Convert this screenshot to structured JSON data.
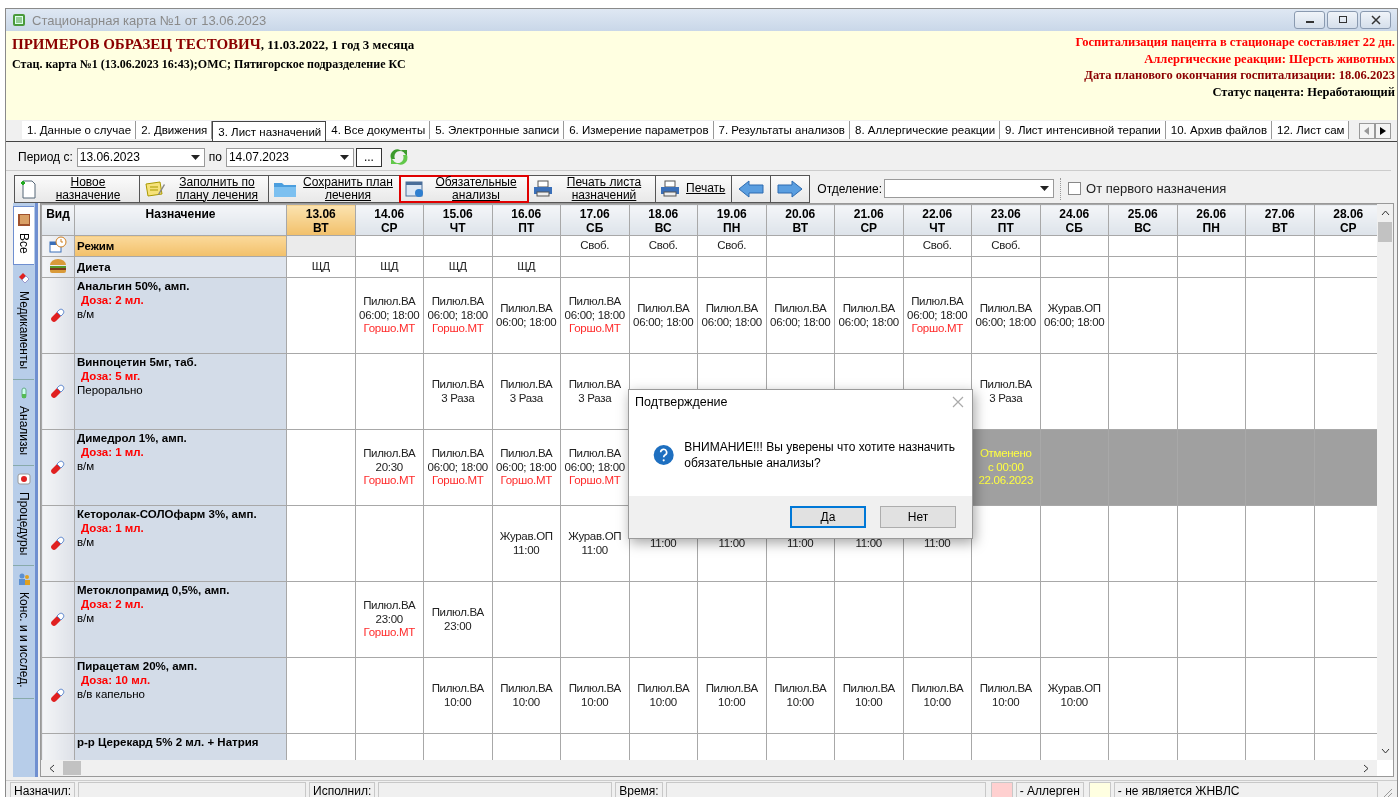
{
  "window": {
    "title": "Стационарная карта №1 от 13.06.2023"
  },
  "header": {
    "patient_name": "ПРИМЕРОВ ОБРАЗЕЦ ТЕСТОВИЧ",
    "birth_info": ", 11.03.2022, 1 год 3 месяца",
    "case_info": "Стац. карта №1 (13.06.2023 16:43);ОМС; Пятигорское подразделение КС",
    "notices": [
      {
        "text": "Госпитализация пацента в стационаре составляет 22 дн.",
        "color": "#ff0000"
      },
      {
        "text": "Аллергические реакции: Шерсть животных",
        "color": "#ff0000"
      },
      {
        "text": "Дата планового окончания госпитализации: 18.06.2023",
        "color": "#8b0000"
      },
      {
        "text": "Статус пацента: Неработающий",
        "color": "#000000"
      }
    ]
  },
  "tabs": [
    {
      "label": "1. Данные о случае",
      "selected": false
    },
    {
      "label": "2. Движения",
      "selected": false
    },
    {
      "label": "3. Лист назначений",
      "selected": true
    },
    {
      "label": "4. Все документы",
      "selected": false
    },
    {
      "label": "5. Электронные записи",
      "selected": false
    },
    {
      "label": "6. Измерение параметров",
      "selected": false
    },
    {
      "label": "7. Результаты анализов",
      "selected": false
    },
    {
      "label": "8. Аллергические реакции",
      "selected": false
    },
    {
      "label": "9. Лист интенсивной терапии",
      "selected": false
    },
    {
      "label": "10. Архив файлов",
      "selected": false
    },
    {
      "label": "12. Лист сам",
      "selected": false
    }
  ],
  "period": {
    "from_label": "Период с:",
    "from": "13.06.2023",
    "to_label": "по",
    "to": "14.07.2023",
    "more_button": "..."
  },
  "toolbar": {
    "buttons": [
      {
        "label": "Новое назначение",
        "highlighted": false
      },
      {
        "label": "Заполнить по плану лечения",
        "highlighted": false
      },
      {
        "label": "Сохранить план лечения",
        "highlighted": false
      },
      {
        "label": "Обязательные анализы",
        "highlighted": true
      },
      {
        "label": "Печать листа назначений",
        "highlighted": false
      },
      {
        "label": "Печать",
        "highlighted": false
      }
    ],
    "department_label": "Отделение:",
    "first_checkbox": {
      "label": "От первого назначения",
      "checked": false
    }
  },
  "side_tabs": [
    {
      "label": "Все",
      "selected": true
    },
    {
      "label": "Медикаменты",
      "selected": false
    },
    {
      "label": "Анализы",
      "selected": false
    },
    {
      "label": "Процедуры",
      "selected": false
    },
    {
      "label": "Конс. и и исслед.",
      "selected": false
    }
  ],
  "table": {
    "columns": [
      "Вид",
      "Назначение"
    ],
    "dates": [
      {
        "date": "13.06",
        "day": "ВТ",
        "today": true
      },
      {
        "date": "14.06",
        "day": "СР",
        "today": false
      },
      {
        "date": "15.06",
        "day": "ЧТ",
        "today": false
      },
      {
        "date": "16.06",
        "day": "ПТ",
        "today": false
      },
      {
        "date": "17.06",
        "day": "СБ",
        "today": false
      },
      {
        "date": "18.06",
        "day": "ВС",
        "today": false
      },
      {
        "date": "19.06",
        "day": "ПН",
        "today": false
      },
      {
        "date": "20.06",
        "day": "ВТ",
        "today": false
      },
      {
        "date": "21.06",
        "day": "СР",
        "today": false
      },
      {
        "date": "22.06",
        "day": "ЧТ",
        "today": false
      },
      {
        "date": "23.06",
        "day": "ПТ",
        "today": false
      },
      {
        "date": "24.06",
        "day": "СБ",
        "today": false
      },
      {
        "date": "25.06",
        "day": "ВС",
        "today": false
      },
      {
        "date": "26.06",
        "day": "ПН",
        "today": false
      },
      {
        "date": "27.06",
        "day": "ВТ",
        "today": false
      },
      {
        "date": "28.06",
        "day": "СР",
        "today": false
      }
    ],
    "rows": [
      {
        "kind": "regime",
        "name": "Режим",
        "selected": true,
        "cells": [
          {
            "shaded": true
          },
          null,
          null,
          null,
          {
            "lines": [
              "Своб."
            ]
          },
          {
            "lines": [
              "Своб."
            ]
          },
          {
            "lines": [
              "Своб."
            ]
          },
          null,
          null,
          {
            "lines": [
              "Своб."
            ]
          },
          {
            "lines": [
              "Своб."
            ]
          },
          null,
          null,
          null,
          null,
          null
        ]
      },
      {
        "kind": "diet",
        "name": "Диета",
        "selected": false,
        "cells": [
          {
            "lines": [
              "ЩД"
            ]
          },
          {
            "lines": [
              "ЩД"
            ]
          },
          {
            "lines": [
              "ЩД"
            ]
          },
          {
            "lines": [
              "ЩД"
            ]
          },
          null,
          null,
          null,
          null,
          null,
          null,
          null,
          null,
          null,
          null,
          null,
          null
        ]
      },
      {
        "kind": "drug",
        "name": "Анальгин 50%, амп.",
        "dose": "Доза: 2 мл.",
        "route": "в/м",
        "selected": false,
        "cells": [
          null,
          {
            "lines": [
              "Пилюл.ВА",
              "06:00; 18:00"
            ],
            "note": "Горшо.МТ"
          },
          {
            "lines": [
              "Пилюл.ВА",
              "06:00; 18:00"
            ],
            "note": "Горшо.МТ"
          },
          {
            "lines": [
              "Пилюл.ВА",
              "06:00; 18:00"
            ]
          },
          {
            "lines": [
              "Пилюл.ВА",
              "06:00; 18:00"
            ],
            "note": "Горшо.МТ"
          },
          {
            "lines": [
              "Пилюл.ВА",
              "06:00; 18:00"
            ]
          },
          {
            "lines": [
              "Пилюл.ВА",
              "06:00; 18:00"
            ]
          },
          {
            "lines": [
              "Пилюл.ВА",
              "06:00; 18:00"
            ]
          },
          {
            "lines": [
              "Пилюл.ВА",
              "06:00; 18:00"
            ]
          },
          {
            "lines": [
              "Пилюл.ВА",
              "06:00; 18:00"
            ],
            "note": "Горшо.МТ"
          },
          {
            "lines": [
              "Пилюл.ВА",
              "06:00; 18:00"
            ]
          },
          {
            "lines": [
              "Журав.ОП",
              "06:00; 18:00"
            ]
          },
          null,
          null,
          null,
          null
        ]
      },
      {
        "kind": "drug",
        "name": "Винпоцетин 5мг, таб.",
        "dose": "Доза: 5 мг.",
        "route": "Перорально",
        "selected": false,
        "cells": [
          null,
          null,
          {
            "lines": [
              "Пилюл.ВА",
              "3 Раза"
            ]
          },
          {
            "lines": [
              "Пилюл.ВА",
              "3 Раза"
            ]
          },
          {
            "lines": [
              "Пилюл.ВА",
              "3 Раза"
            ]
          },
          null,
          null,
          null,
          null,
          null,
          {
            "lines": [
              "Пилюл.ВА",
              "3 Раза"
            ]
          },
          null,
          null,
          null,
          null,
          null
        ]
      },
      {
        "kind": "drug",
        "name": "Димедрол 1%, амп.",
        "dose": "Доза: 1 мл.",
        "route": "в/м",
        "selected": false,
        "cells": [
          null,
          {
            "lines": [
              "Пилюл.ВА",
              "20:30"
            ],
            "note": "Горшо.МТ"
          },
          {
            "lines": [
              "Пилюл.ВА",
              "06:00; 18:00"
            ],
            "note": "Горшо.МТ"
          },
          {
            "lines": [
              "Пилюл.ВА",
              "06:00; 18:00"
            ],
            "note": "Горшо.МТ"
          },
          {
            "lines": [
              "Пилюл.ВА",
              "06:00; 18:00"
            ],
            "note": "Горшо.МТ"
          },
          null,
          null,
          null,
          null,
          null,
          {
            "cancelled": true,
            "lines": [
              "Отменено",
              "с 00:00",
              "22.06.2023"
            ]
          },
          {
            "cancelled": true
          },
          {
            "cancelled": true
          },
          {
            "cancelled": true
          },
          {
            "cancelled": true
          },
          {
            "cancelled": true
          }
        ]
      },
      {
        "kind": "drug",
        "name": "Кеторолак-СОЛОфарм 3%, амп.",
        "dose": "Доза: 1 мл.",
        "route": "в/м",
        "selected": false,
        "cells": [
          null,
          null,
          null,
          {
            "lines": [
              "Журав.ОП",
              "11:00"
            ]
          },
          {
            "lines": [
              "Журав.ОП",
              "11:00"
            ]
          },
          {
            "lines": [
              "11:00"
            ]
          },
          {
            "lines": [
              "11:00"
            ]
          },
          {
            "lines": [
              "11:00"
            ]
          },
          {
            "lines": [
              "11:00"
            ]
          },
          {
            "lines": [
              "11:00"
            ]
          },
          null,
          null,
          null,
          null,
          null,
          null
        ]
      },
      {
        "kind": "drug",
        "name": "Метоклопрамид 0,5%, амп.",
        "dose": "Доза: 2 мл.",
        "route": "в/м",
        "selected": false,
        "cells": [
          null,
          {
            "lines": [
              "Пилюл.ВА",
              "23:00"
            ],
            "note": "Горшо.МТ"
          },
          {
            "lines": [
              "Пилюл.ВА",
              "23:00"
            ]
          },
          null,
          null,
          null,
          null,
          null,
          null,
          null,
          null,
          null,
          null,
          null,
          null,
          null
        ]
      },
      {
        "kind": "drug",
        "name": "Пирацетам 20%, амп.",
        "dose": "Доза: 10 мл.",
        "route": "в/в капельно",
        "selected": false,
        "cells": [
          null,
          null,
          {
            "lines": [
              "Пилюл.ВА",
              "10:00"
            ]
          },
          {
            "lines": [
              "Пилюл.ВА",
              "10:00"
            ]
          },
          {
            "lines": [
              "Пилюл.ВА",
              "10:00"
            ]
          },
          {
            "lines": [
              "Пилюл.ВА",
              "10:00"
            ]
          },
          {
            "lines": [
              "Пилюл.ВА",
              "10:00"
            ]
          },
          {
            "lines": [
              "Пилюл.ВА",
              "10:00"
            ]
          },
          {
            "lines": [
              "Пилюл.ВА",
              "10:00"
            ]
          },
          {
            "lines": [
              "Пилюл.ВА",
              "10:00"
            ]
          },
          {
            "lines": [
              "Пилюл.ВА",
              "10:00"
            ]
          },
          {
            "lines": [
              "Журав.ОП",
              "10:00"
            ]
          },
          null,
          null,
          null,
          null
        ]
      },
      {
        "kind": "drug",
        "name": "р-р Церекард 5% 2 мл. + Натрия",
        "selected": false,
        "cells": [
          null,
          null,
          null,
          null,
          null,
          null,
          null,
          null,
          null,
          null,
          null,
          null,
          null,
          null,
          null,
          null
        ]
      }
    ]
  },
  "status_bar": {
    "assigned_label": "Назначил:",
    "executed_label": "Исполнил:",
    "time_label": "Время:",
    "legend": [
      {
        "color": "#ffd0d0",
        "label": "- Аллерген"
      },
      {
        "color": "#ffffe1",
        "label": "- не является ЖНВЛС"
      }
    ]
  },
  "dialog": {
    "title": "Подтверждение",
    "message": "ВНИМАНИЕ!!! Вы уверены что хотите назначить обязательные анализы?",
    "buttons": [
      {
        "label": "Да",
        "default": true
      },
      {
        "label": "Нет",
        "default": false
      }
    ]
  }
}
